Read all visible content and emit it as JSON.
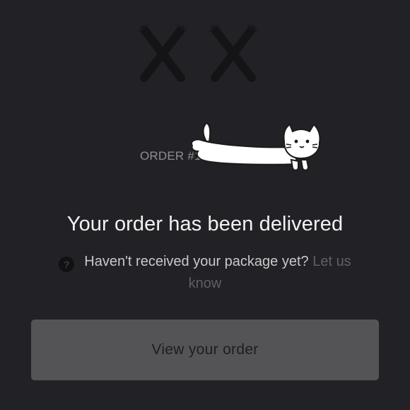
{
  "logo": {
    "icon": "xx-logo-icon",
    "color": "#141416"
  },
  "order": {
    "number": "ORDER #1"
  },
  "sticker": {
    "icon": "long-cat-sticker-icon"
  },
  "headline": "Your order has been delivered",
  "help": {
    "icon": "question-circle-icon",
    "icon_glyph": "?",
    "text": "Haven't received your package yet?",
    "link_text": "Let us know"
  },
  "primary_button": {
    "label": "View your order"
  },
  "colors": {
    "background": "#222226",
    "button": "#545457",
    "link": "#5f5f64",
    "headline": "#f2f2f2"
  }
}
